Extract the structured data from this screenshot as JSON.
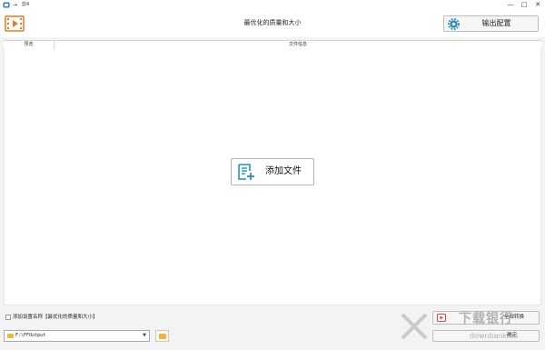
{
  "window": {
    "back_arrow": "→",
    "title": "剪4",
    "minimize": "—",
    "maximize": "□",
    "close": "✕"
  },
  "header": {
    "mode_title": "最优化的质量和大小",
    "output_button": "输出配置"
  },
  "table": {
    "columns": [
      "预览",
      "文件信息"
    ]
  },
  "main": {
    "add_file_label": "添加文件"
  },
  "bottom": {
    "checkbox_label": "添加设置名称【最优化的质量和大小】",
    "checkbox_checked": false,
    "output_path": "F:\\FFOutput",
    "convert_label": "全部转换",
    "confirm_label": "确定"
  },
  "watermark": {
    "title": "下载银行",
    "url": "downbank.cn"
  },
  "colors": {
    "accent": "#2a8fb0",
    "film_orange": "#e07a1f",
    "folder": "#f0b43a"
  }
}
